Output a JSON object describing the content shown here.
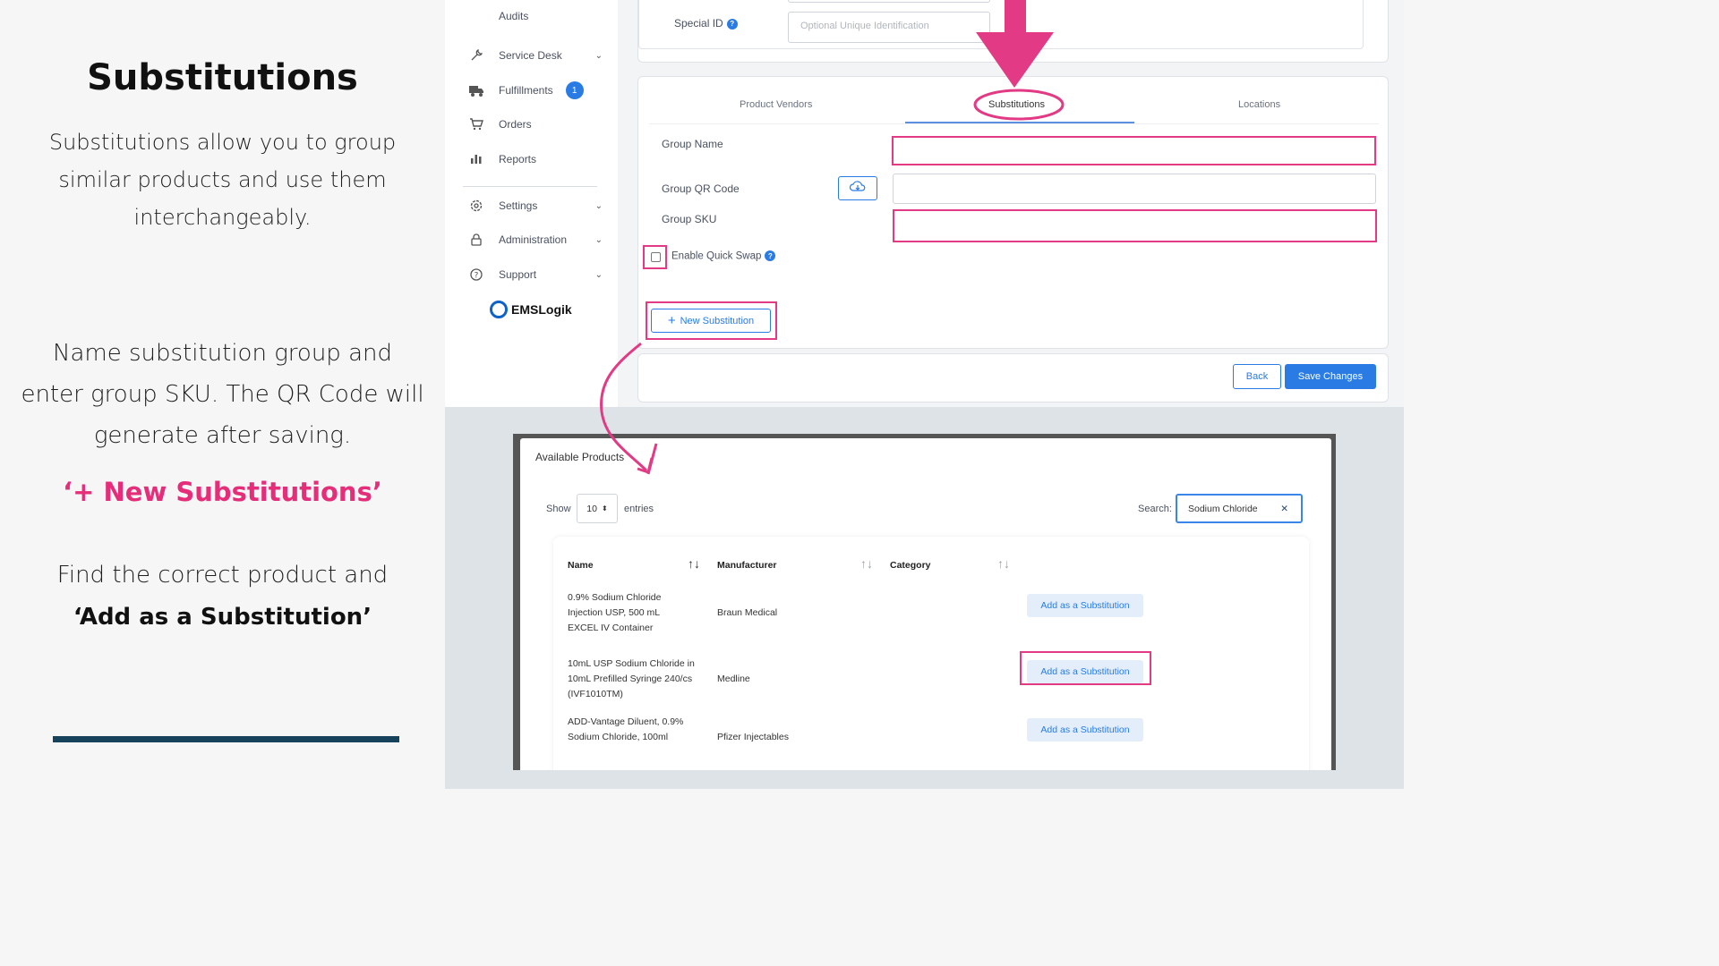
{
  "instructions": {
    "title": "Substitutions",
    "intro": "Substitutions allow you to group similar products and use them interchangeably.",
    "step1": "Name substitution group and enter group SKU. The QR Code will generate after saving.",
    "step2": "‘+ New Substitutions’",
    "step3_prefix": "Find the correct product and",
    "step3_action": "‘Add as a Substitution’"
  },
  "sidebar": {
    "items": [
      {
        "label": "Audits"
      },
      {
        "label": "Service Desk",
        "icon": "wrench-icon",
        "chevron": "⌄"
      },
      {
        "label": "Fulfillments",
        "icon": "truck-icon",
        "badge": "1"
      },
      {
        "label": "Orders",
        "icon": "cart-icon"
      },
      {
        "label": "Reports",
        "icon": "bar-chart-icon"
      },
      {
        "label": "Settings",
        "icon": "gear-icon",
        "chevron": "⌄"
      },
      {
        "label": "Administration",
        "icon": "lock-icon",
        "chevron": "⌄"
      },
      {
        "label": "Support",
        "icon": "help-icon",
        "chevron": "⌄"
      }
    ],
    "logo": "EMSLogik"
  },
  "form": {
    "special_id_label": "Special ID",
    "special_id_placeholder": "Optional Unique Identification",
    "tabs": [
      "Product Vendors",
      "Substitutions",
      "Locations"
    ],
    "group_name_label": "Group Name",
    "group_name_value": "",
    "group_qr_label": "Group QR Code",
    "group_sku_label": "Group SKU",
    "group_sku_value": "",
    "quick_swap_label": "Enable Quick Swap",
    "new_sub_button": "New Substitution",
    "back_button": "Back",
    "save_button": "Save Changes"
  },
  "modal": {
    "title": "Available Products",
    "show_label": "Show",
    "entries_value": "10",
    "entries_label": "entries",
    "search_label": "Search:",
    "search_value": "Sodium Chloride",
    "columns": [
      "Name",
      "Manufacturer",
      "Category"
    ],
    "rows": [
      {
        "name": "0.9% Sodium Chloride Injection USP, 500 mL EXCEL IV Container",
        "manufacturer": "Braun Medical",
        "category": "",
        "action": "Add as a Substitution"
      },
      {
        "name": "10mL USP Sodium Chloride in 10mL Prefilled Syringe 240/cs (IVF1010TM)",
        "manufacturer": "Medline",
        "category": "",
        "action": "Add as a Substitution"
      },
      {
        "name": "ADD-Vantage Diluent, 0.9% Sodium Chloride, 100ml",
        "manufacturer": "Pfizer Injectables",
        "category": "",
        "action": "Add as a Substitution"
      }
    ]
  },
  "colors": {
    "accent_pink": "#e62d7a",
    "primary_blue": "#2a7be4",
    "divider_navy": "#17425c"
  }
}
